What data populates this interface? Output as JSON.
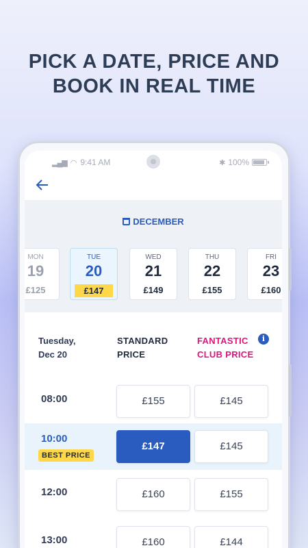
{
  "headline": {
    "line1": "PICK A DATE, PRICE AND",
    "line2": "BOOK IN REAL TIME"
  },
  "status_bar": {
    "time": "9:41 AM",
    "battery": "100%"
  },
  "calendar": {
    "month": "DECEMBER",
    "days": [
      {
        "name": "MON",
        "date": "19",
        "price": "£125"
      },
      {
        "name": "TUE",
        "date": "20",
        "price": "£147"
      },
      {
        "name": "WED",
        "date": "21",
        "price": "£149"
      },
      {
        "name": "THU",
        "date": "22",
        "price": "£155"
      },
      {
        "name": "FRI",
        "date": "23",
        "price": "£160"
      }
    ]
  },
  "table": {
    "date_line1": "Tuesday,",
    "date_line2": "Dec 20",
    "standard_line1": "STANDARD",
    "standard_line2": "PRICE",
    "club_line1": "FANTASTIC",
    "club_line2": "CLUB PRICE",
    "info_glyph": "i",
    "best_price_label": "BEST PRICE",
    "rows": [
      {
        "time": "08:00",
        "standard": "£155",
        "club": "£145"
      },
      {
        "time": "10:00",
        "standard": "£147",
        "club": "£145"
      },
      {
        "time": "12:00",
        "standard": "£160",
        "club": "£155"
      },
      {
        "time": "13:00",
        "standard": "£160",
        "club": "£144"
      }
    ]
  },
  "colors": {
    "accent": "#2a5bbf",
    "club": "#e0127f",
    "highlight": "#ffd84a"
  }
}
